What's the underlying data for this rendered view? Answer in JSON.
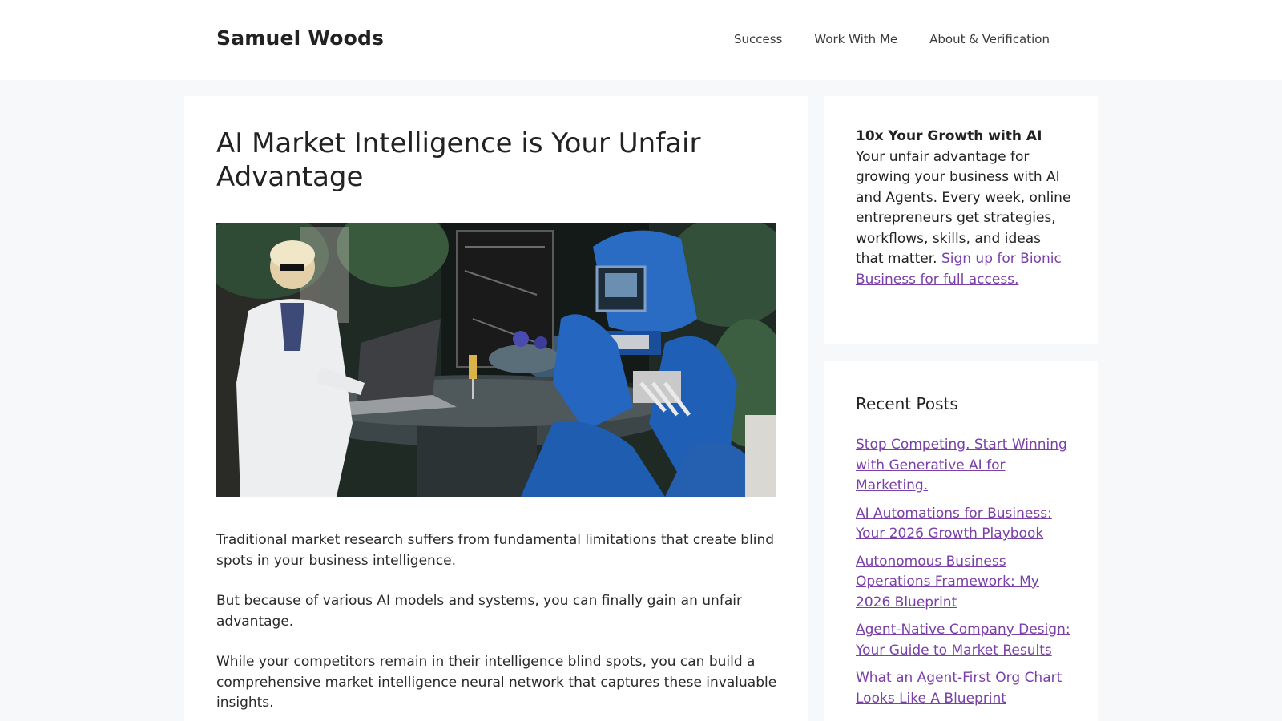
{
  "header": {
    "site_title": "Samuel Woods",
    "nav": [
      "Success",
      "Work With Me",
      "About & Verification"
    ]
  },
  "article": {
    "title": "AI Market Intelligence is Your Unfair Advantage",
    "featured_image_description_icon": "photo-woman-laptop-robot",
    "paragraphs": [
      "Traditional market research suffers from fundamental limitations that create blind spots in your business intelligence.",
      "But because of various AI models and systems, you can finally gain an unfair advantage.",
      "While your competitors remain in their intelligence blind spots, you can build a comprehensive market intelligence neural network that captures these invaluable insights."
    ]
  },
  "sidebar": {
    "newsletter": {
      "heading": "10x Your Growth with AI",
      "body": "Your unfair advantage for growing your business with AI and Agents. Every week, online entrepreneurs get strategies, workflows, skills, and ideas that matter.",
      "link_text": "Sign up for Bionic Business for full access."
    },
    "recent_posts": {
      "title": "Recent Posts",
      "items": [
        "Stop Competing. Start Winning with Generative AI for Marketing.",
        "AI Automations for Business: Your 2026 Growth Playbook",
        "Autonomous Business Operations Framework: My 2026 Blueprint",
        "Agent-Native Company Design: Your Guide to Market Results",
        "What an Agent-First Org Chart Looks Like A Blueprint"
      ]
    }
  },
  "colors": {
    "link": "#7a3fa8",
    "page_bg": "#f7f8f9",
    "card_bg": "#ffffff",
    "text": "#222222"
  }
}
